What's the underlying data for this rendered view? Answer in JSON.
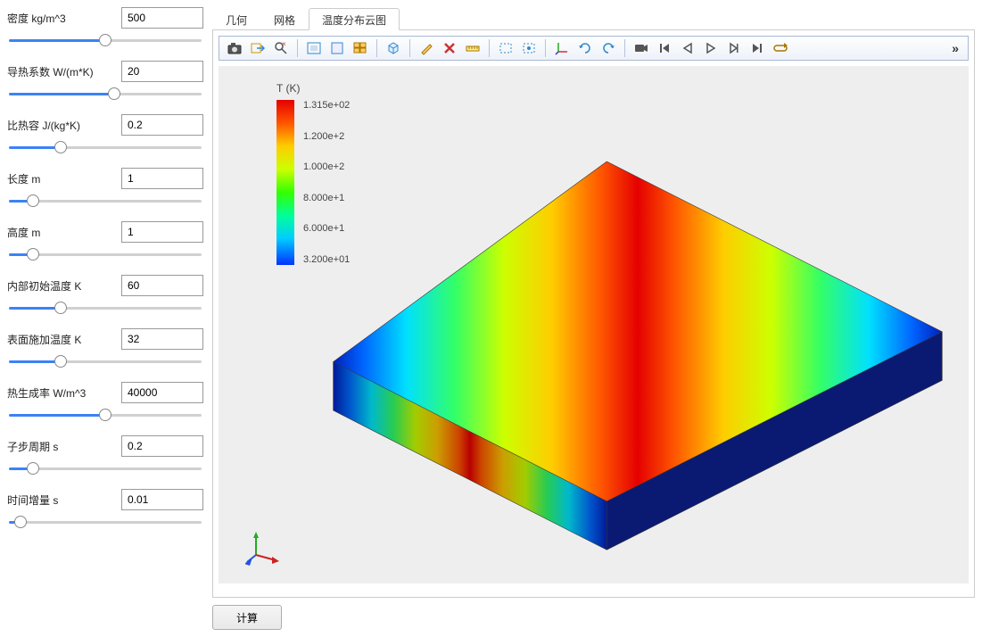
{
  "params": [
    {
      "label": "密度 kg/m^3",
      "value": "500",
      "pct": 50
    },
    {
      "label": "导热系数 W/(m*K)",
      "value": "20",
      "pct": 55
    },
    {
      "label": "比热容 J/(kg*K)",
      "value": "0.2",
      "pct": 25
    },
    {
      "label": "长度 m",
      "value": "1",
      "pct": 10
    },
    {
      "label": "高度 m",
      "value": "1",
      "pct": 10
    },
    {
      "label": "内部初始温度 K",
      "value": "60",
      "pct": 25
    },
    {
      "label": "表面施加温度 K",
      "value": "32",
      "pct": 25
    },
    {
      "label": "热生成率 W/m^3",
      "value": "40000",
      "pct": 50
    },
    {
      "label": "子步周期 s",
      "value": "0.2",
      "pct": 10
    },
    {
      "label": "时间增量 s",
      "value": "0.01",
      "pct": 3
    }
  ],
  "tabs": [
    "几何",
    "网格",
    "温度分布云图"
  ],
  "active_tab": 2,
  "legend_title": "T (K)",
  "legend_ticks": [
    "1.315e+02",
    "1.200e+2",
    "1.000e+2",
    "8.000e+1",
    "6.000e+1",
    "3.200e+01"
  ],
  "calc_label": "计算",
  "toolbar_icons": [
    "camera-icon",
    "export-icon",
    "zoom-reset-icon",
    "sep",
    "fit-view-icon",
    "box-icon",
    "multi-view-icon",
    "sep",
    "volume-icon",
    "sep",
    "brush-icon",
    "delete-x-icon",
    "ruler-icon",
    "sep",
    "select-region-icon",
    "select-all-icon",
    "sep",
    "axes-icon",
    "rotate-cw-icon",
    "rotate-ccw-icon",
    "sep",
    "record-icon",
    "skip-start-icon",
    "step-back-icon",
    "play-icon",
    "step-forward-icon",
    "skip-end-icon",
    "loop-icon"
  ],
  "more_label": "»",
  "chart_data": {
    "type": "heatmap",
    "title": "T (K)",
    "colormap": "rainbow",
    "range": [
      32.0,
      131.5
    ],
    "ticks": [
      131.5,
      120,
      100,
      80,
      60,
      32
    ],
    "geometry": "rectangular slab, isometric view",
    "distribution": "high temperature (red) along central diagonal band, decreasing to low temperature (blue) at left/right edges"
  }
}
